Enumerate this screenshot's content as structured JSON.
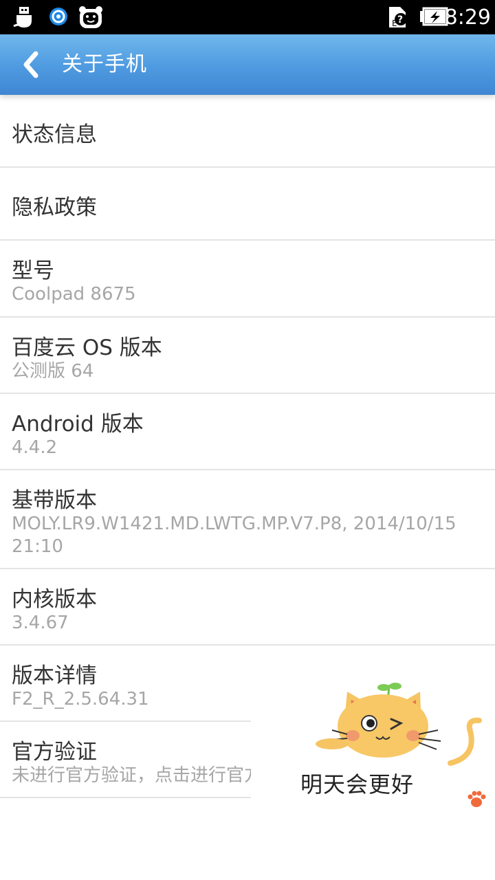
{
  "status_bar": {
    "time": "8:29",
    "icons": [
      "usb-icon",
      "sync-app-icon",
      "bear-app-icon",
      "sim-unknown-icon",
      "battery-charging-icon"
    ]
  },
  "action_bar": {
    "title": "关于手机",
    "back_icon": "chevron-left-icon"
  },
  "list": {
    "items": [
      {
        "title": "状态信息",
        "subtitle": ""
      },
      {
        "title": "隐私政策",
        "subtitle": ""
      },
      {
        "title": "型号",
        "subtitle": "Coolpad 8675"
      },
      {
        "title": "百度云 OS 版本",
        "subtitle": "公测版 64"
      },
      {
        "title": "Android 版本",
        "subtitle": "4.4.2"
      },
      {
        "title": "基带版本",
        "subtitle": "MOLY.LR9.W1421.MD.LWTG.MP.V7.P8, 2014/10/15 21:10"
      },
      {
        "title": "内核版本",
        "subtitle": "3.4.67"
      },
      {
        "title": "版本详情",
        "subtitle": "F2_R_2.5.64.31"
      },
      {
        "title": "官方验证",
        "subtitle": "未进行官方验证，点击进行官方"
      }
    ]
  },
  "widget": {
    "caption": "明天会更好",
    "icon": "cat-sticker-icon",
    "paw_icon": "paw-icon"
  },
  "colors": {
    "action_bar": "#4e9ae0",
    "title_text": "#333333",
    "subtitle_text": "#a6a6a6",
    "divider": "#e4e4e4"
  }
}
